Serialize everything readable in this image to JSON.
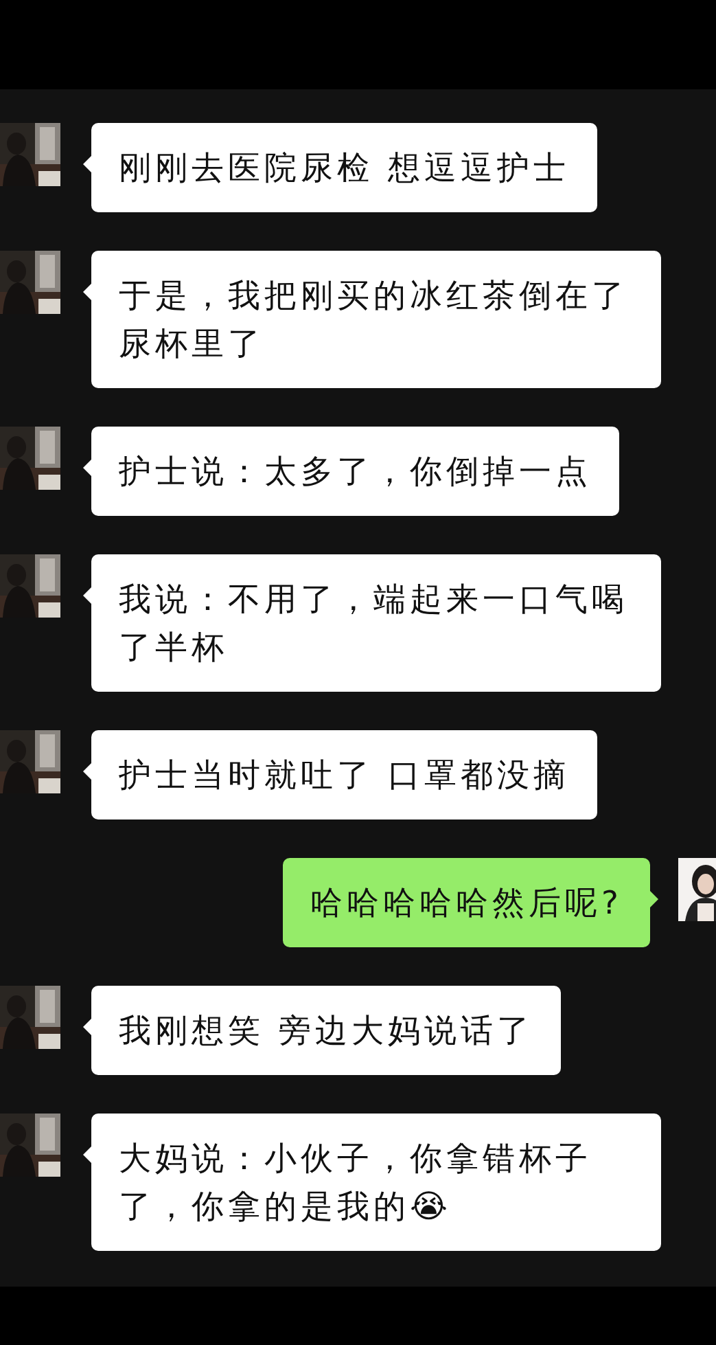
{
  "messages": [
    {
      "kind": "incoming",
      "text": "刚刚去医院尿检 想逗逗护士"
    },
    {
      "kind": "incoming",
      "text": "于是，我把刚买的冰红茶倒在了尿杯里了"
    },
    {
      "kind": "incoming",
      "text": "护士说：太多了，你倒掉一点"
    },
    {
      "kind": "incoming",
      "text": "我说：不用了，端起来一口气喝了半杯"
    },
    {
      "kind": "incoming",
      "text": "护士当时就吐了 口罩都没摘"
    },
    {
      "kind": "outgoing",
      "text": "哈哈哈哈哈然后呢?"
    },
    {
      "kind": "incoming",
      "text": "我刚想笑 旁边大妈说话了"
    },
    {
      "kind": "incoming",
      "text": "大妈说：小伙子，你拿错杯子了，你拿的是我的😭"
    }
  ]
}
